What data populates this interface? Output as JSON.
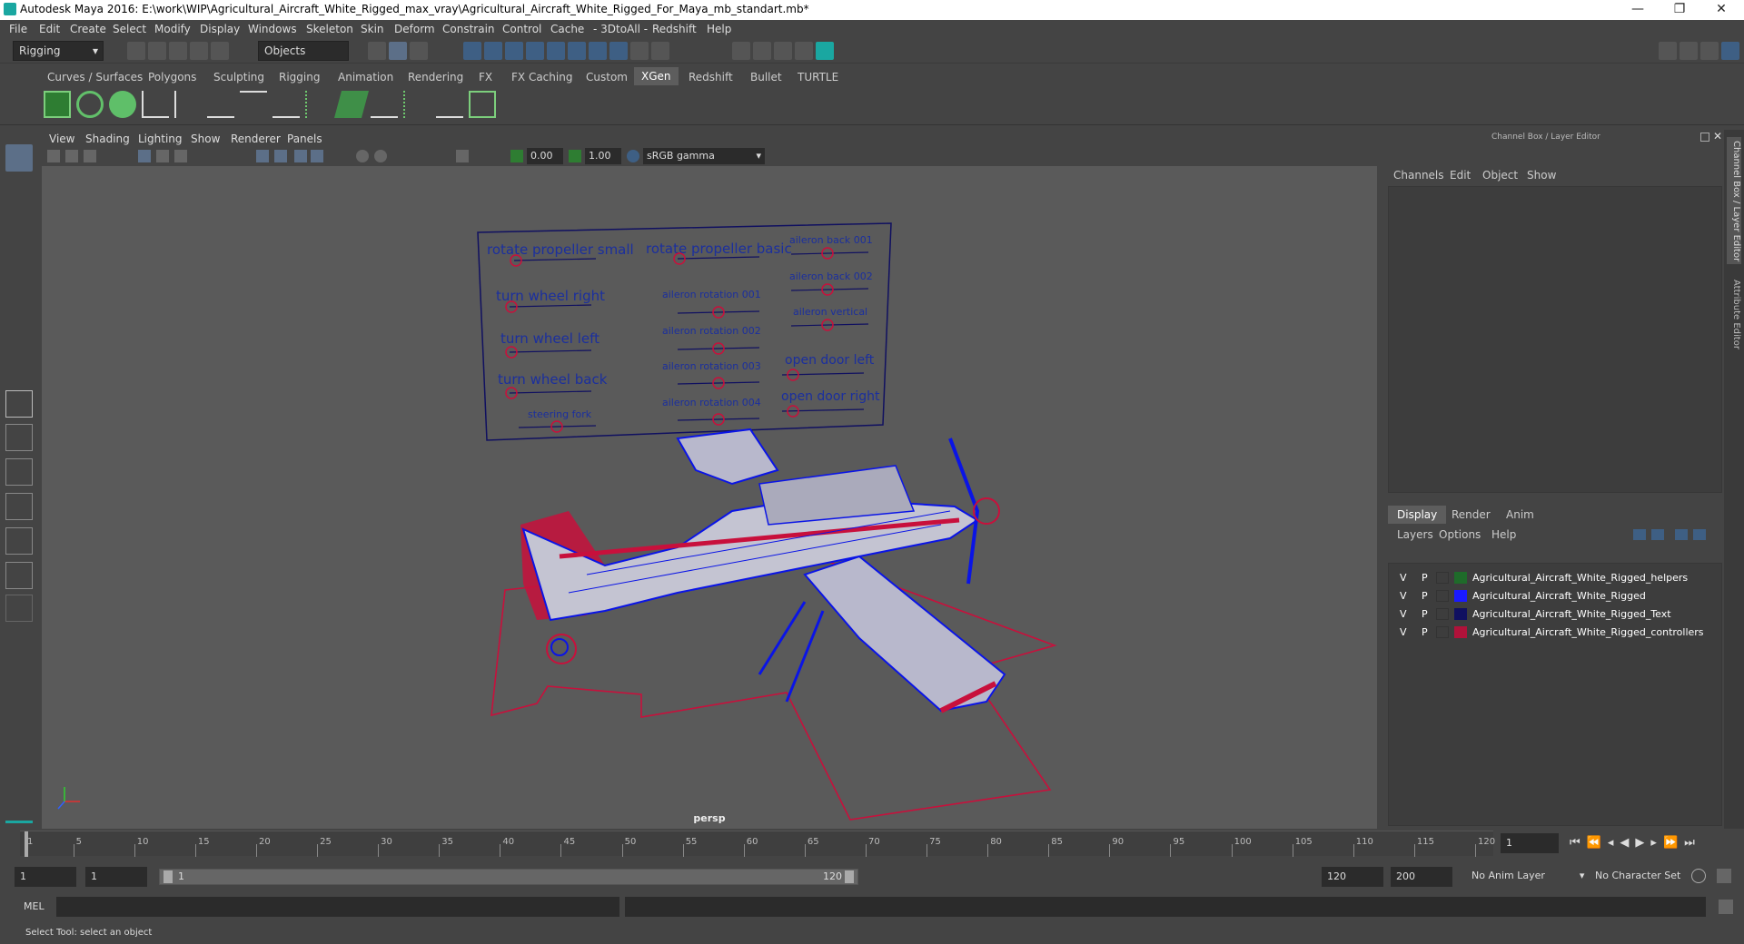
{
  "window": {
    "title": "Autodesk Maya 2016: E:\\work\\WIP\\Agricultural_Aircraft_White_Rigged_max_vray\\Agricultural_Aircraft_White_Rigged_For_Maya_mb_standart.mb*",
    "controls": [
      "—",
      "❐",
      "✕"
    ]
  },
  "menubar": [
    "File",
    "Edit",
    "Create",
    "Select",
    "Modify",
    "Display",
    "Windows",
    "Skeleton",
    "Skin",
    "Deform",
    "Constrain",
    "Control",
    "Cache",
    "- 3DtoAll -",
    "Redshift",
    "Help"
  ],
  "statusline": {
    "mode": "Rigging",
    "selection": "Objects"
  },
  "shelf_tabs": [
    "Curves / Surfaces",
    "Polygons",
    "Sculpting",
    "Rigging",
    "Animation",
    "Rendering",
    "FX",
    "FX Caching",
    "Custom",
    "XGen",
    "Redshift",
    "Bullet",
    "TURTLE"
  ],
  "shelf_active": "XGen",
  "panel_menu": [
    "View",
    "Shading",
    "Lighting",
    "Show",
    "Renderer",
    "Panels"
  ],
  "panel_toolbar": {
    "exposure": "0.00",
    "gamma": "1.00",
    "color_space": "sRGB gamma"
  },
  "viewport": {
    "camera": "persp",
    "controls_board": {
      "col1": [
        "rotate propeller small",
        "turn wheel right",
        "turn wheel left",
        "turn wheel back",
        "steering fork"
      ],
      "col2": [
        "rotate propeller basic",
        "aileron rotation 001",
        "aileron rotation 002",
        "aileron rotation 003",
        "aileron rotation 004"
      ],
      "col3": [
        "aileron back 001",
        "aileron back 002",
        "aileron vertical",
        "open door left",
        "open door right"
      ]
    }
  },
  "channel_box": {
    "title": "Channel Box / Layer Editor",
    "menu": [
      "Channels",
      "Edit",
      "Object",
      "Show"
    ]
  },
  "layer_editor": {
    "tabs": [
      "Display",
      "Render",
      "Anim"
    ],
    "active_tab": "Display",
    "menu": [
      "Layers",
      "Options",
      "Help"
    ],
    "layers": [
      {
        "v": "V",
        "p": "P",
        "color": "#1f6b2a",
        "name": "Agricultural_Aircraft_White_Rigged_helpers"
      },
      {
        "v": "V",
        "p": "P",
        "color": "#1a1aff",
        "name": "Agricultural_Aircraft_White_Rigged"
      },
      {
        "v": "V",
        "p": "P",
        "color": "#101060",
        "name": "Agricultural_Aircraft_White_Rigged_Text"
      },
      {
        "v": "V",
        "p": "P",
        "color": "#b0123a",
        "name": "Agricultural_Aircraft_White_Rigged_controllers"
      }
    ]
  },
  "side_tabs": [
    "Channel Box / Layer Editor",
    "Attribute Editor"
  ],
  "timeline": {
    "ticks": [
      "1",
      "5",
      "10",
      "15",
      "20",
      "25",
      "30",
      "35",
      "40",
      "45",
      "50",
      "55",
      "60",
      "65",
      "70",
      "75",
      "80",
      "85",
      "90",
      "95",
      "100",
      "105",
      "110",
      "115",
      "120"
    ],
    "current_frame": "1"
  },
  "range": {
    "start": "1",
    "playback_start": "1",
    "slider_start": "1",
    "slider_end": "120",
    "playback_end": "120",
    "end": "200",
    "anim_layer": "No Anim Layer",
    "char_set": "No Character Set"
  },
  "command_line": {
    "label": "MEL"
  },
  "help_line": "Select Tool: select an object",
  "colors": {
    "wire": "#0a14e6",
    "control": "#c8103c",
    "accent": "#1aa7a1"
  }
}
